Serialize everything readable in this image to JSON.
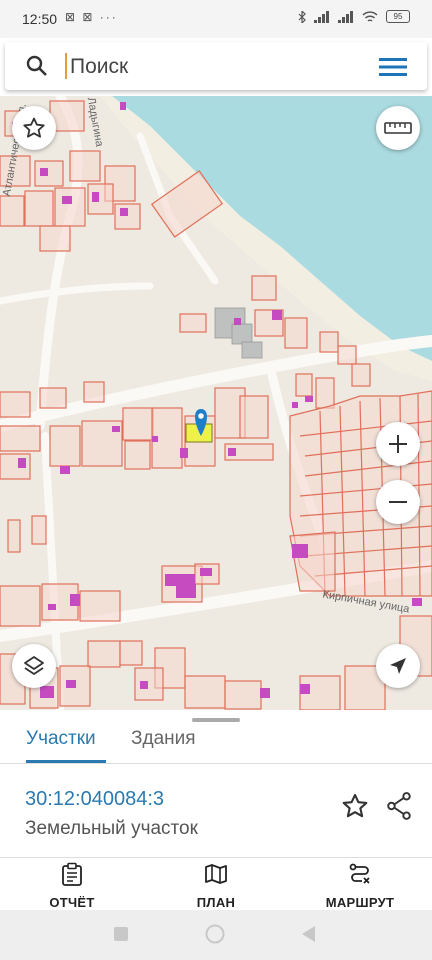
{
  "status_bar": {
    "time": "12:50",
    "extra_icons": "⊠ ⊠ ···",
    "battery": "95"
  },
  "search": {
    "placeholder": "Поиск"
  },
  "map": {
    "street_labels": [
      "Атлантическая ул.",
      "Кирпичная улица",
      "Ладыгина"
    ],
    "colors": {
      "water": "#aadbe0",
      "parcel_stroke": "#e0705a",
      "parcel_fill": "#f6d6cc",
      "building": "#c64bc1",
      "selected_parcel": "#f0f04a",
      "marker": "#1e7fc8"
    }
  },
  "sheet": {
    "tabs": [
      {
        "label": "Участки",
        "active": true
      },
      {
        "label": "Здания",
        "active": false
      }
    ],
    "cadastral_number": "30:12:040084:3",
    "object_type": "Земельный участок"
  },
  "bottom_actions": [
    {
      "label": "ОТЧЁТ",
      "icon": "report-clipboard-icon"
    },
    {
      "label": "ПЛАН",
      "icon": "map-plan-icon"
    },
    {
      "label": "МАРШРУТ",
      "icon": "route-icon"
    }
  ]
}
